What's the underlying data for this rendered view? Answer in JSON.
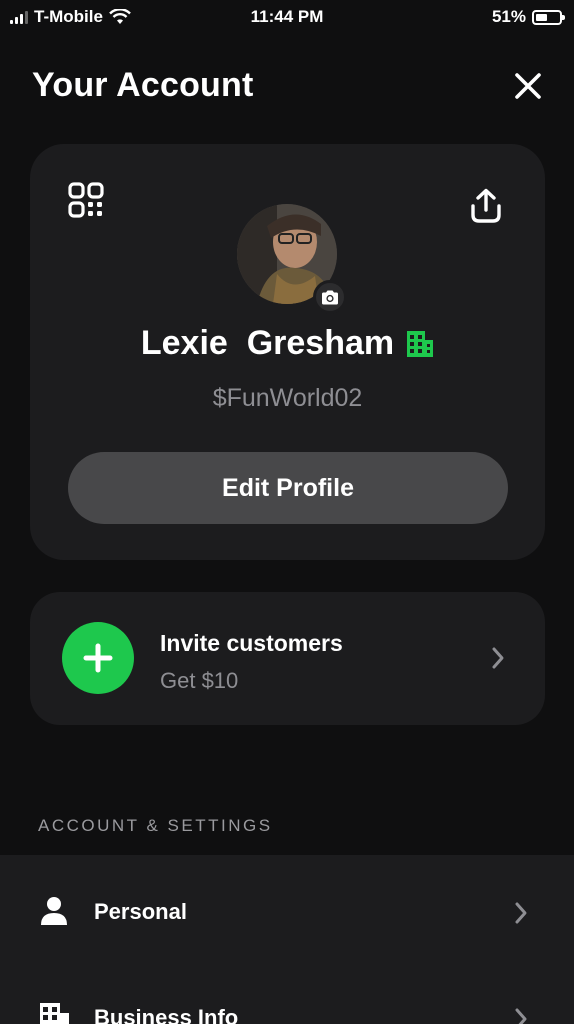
{
  "status_bar": {
    "carrier": "T-Mobile",
    "time": "11:44 PM",
    "battery_text": "51%",
    "battery_level": 0.51
  },
  "header": {
    "title": "Your Account",
    "close_icon": "close-icon"
  },
  "profile": {
    "first_name": "Lexie",
    "last_name": "Gresham",
    "full_name": "Lexie  Gresham",
    "cashtag": "$FunWorld02",
    "edit_label": "Edit Profile",
    "business_badge_color": "#1ec84d",
    "icons": [
      "qr-code-icon",
      "share-icon",
      "camera-icon",
      "business-building-icon"
    ]
  },
  "invite": {
    "title": "Invite customers",
    "subtitle": "Get $10",
    "accent": "#1ec84d"
  },
  "settings": {
    "section_label": "ACCOUNT & SETTINGS",
    "items": [
      {
        "label": "Personal",
        "icon": "person-icon"
      },
      {
        "label": "Business Info",
        "icon": "business-building-icon"
      }
    ]
  },
  "colors": {
    "background": "#0f0f10",
    "card": "#1c1c1e",
    "button": "#48484a",
    "green": "#1ec84d",
    "muted_text": "#8e8e93"
  }
}
